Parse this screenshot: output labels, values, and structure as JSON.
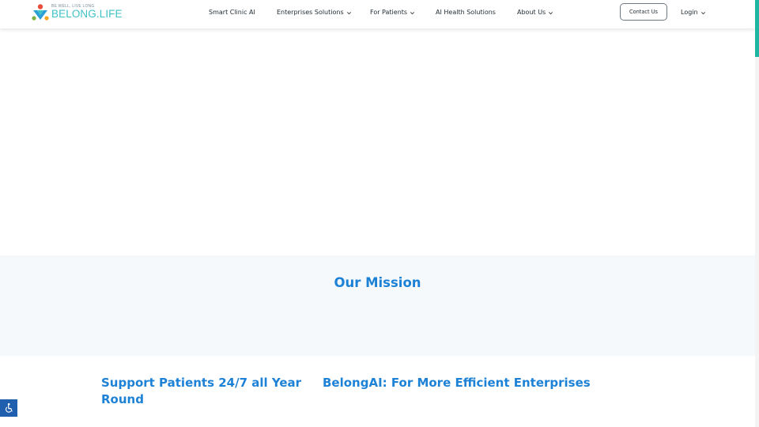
{
  "header": {
    "logo": {
      "tagline": "BE WELL, LIVE LONG",
      "name": "BELONG.LIFE"
    },
    "nav": [
      {
        "label": "Smart Clinic AI",
        "dropdown": false
      },
      {
        "label": "Enterprises Solutions",
        "dropdown": true
      },
      {
        "label": "For Patients",
        "dropdown": true
      },
      {
        "label": "AI Health Solutions",
        "dropdown": false
      },
      {
        "label": "About Us",
        "dropdown": true
      }
    ],
    "contact_label": "Contact Us",
    "login_label": "Login"
  },
  "mission": {
    "title": "Our Mission"
  },
  "cards": [
    {
      "title": "Support Patients 24/7 all Year Round"
    },
    {
      "title": "BelongAI: For More Efficient Enterprises"
    }
  ],
  "colors": {
    "accent": "#1d82d6",
    "teal": "#3fc2c6",
    "scroll_accent": "#1fb5a3",
    "a11y": "#1f5fae"
  },
  "icons": [
    "belong-logo-icon",
    "chevron-down-icon",
    "accessibility-icon"
  ]
}
